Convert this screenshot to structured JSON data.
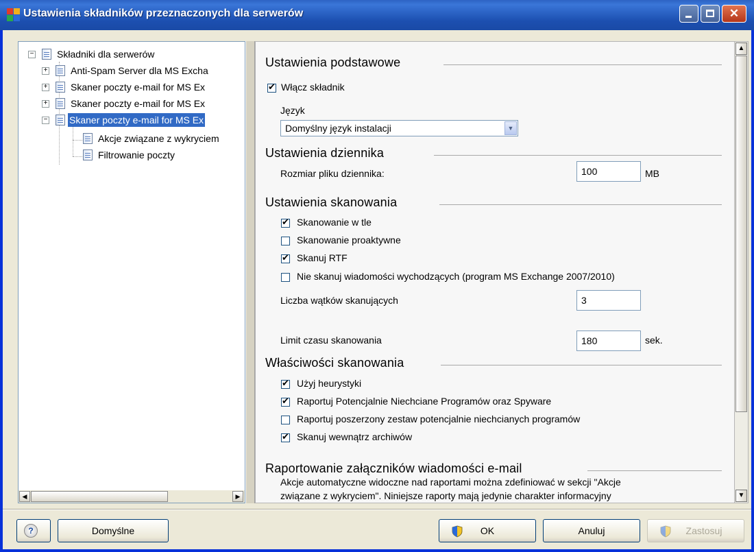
{
  "window": {
    "title": "Ustawienia składników przeznaczonych dla serwerów",
    "colors": {
      "titlebar": "#1c4fb0",
      "selection": "#316ac5",
      "frame": "#ece9d8"
    }
  },
  "tree": {
    "root": "Składniki dla serwerów",
    "items": [
      {
        "label": "Anti-Spam Server dla MS Excha",
        "expander": "+"
      },
      {
        "label": "Skaner poczty e-mail for MS Ex",
        "expander": "+"
      },
      {
        "label": "Skaner poczty e-mail for MS Ex",
        "expander": "+"
      },
      {
        "label": "Skaner poczty e-mail for MS Ex",
        "expander": "−",
        "selected": true
      }
    ],
    "children": [
      {
        "label": "Akcje związane z wykryciem"
      },
      {
        "label": "Filtrowanie poczty"
      }
    ]
  },
  "settings": {
    "basic": {
      "heading": "Ustawienia podstawowe",
      "enable_label": "Włącz składnik",
      "enable_checked": true,
      "language_label": "Język",
      "language_value": "Domyślny język instalacji"
    },
    "log": {
      "heading": "Ustawienia dziennika",
      "size_label": "Rozmiar pliku dziennika:",
      "size_value": "100",
      "size_unit": "MB"
    },
    "scan": {
      "heading": "Ustawienia skanowania",
      "options": [
        {
          "label": "Skanowanie w tle",
          "checked": true
        },
        {
          "label": "Skanowanie proaktywne",
          "checked": false
        },
        {
          "label": "Skanuj RTF",
          "checked": true
        },
        {
          "label": "Nie skanuj wiadomości wychodzących (program MS Exchange 2007/2010)",
          "checked": false
        }
      ],
      "threads_label": "Liczba wątków skanujących",
      "threads_value": "3",
      "timeout_label": "Limit czasu skanowania",
      "timeout_value": "180",
      "timeout_unit": "sek."
    },
    "props": {
      "heading": "Właściwości skanowania",
      "options": [
        {
          "label": "Użyj heurystyki",
          "checked": true
        },
        {
          "label": "Raportuj Potencjalnie Niechciane Programów oraz Spyware",
          "checked": true
        },
        {
          "label": "Raportuj poszerzony zestaw potencjalnie niechcianych programów",
          "checked": false
        },
        {
          "label": "Skanuj wewnątrz archiwów",
          "checked": true
        }
      ]
    },
    "attachments": {
      "heading": "Raportowanie załączników wiadomości e-mail",
      "line1": "Akcje automatyczne widoczne nad raportami można zdefiniować w sekcji \"Akcje",
      "line2": "związane z wykryciem\". Niniejsze raporty mają jedynie charakter informacyjny"
    }
  },
  "buttons": {
    "help": "?",
    "defaults": "Domyślne",
    "ok": "OK",
    "cancel": "Anuluj",
    "apply": "Zastosuj"
  }
}
